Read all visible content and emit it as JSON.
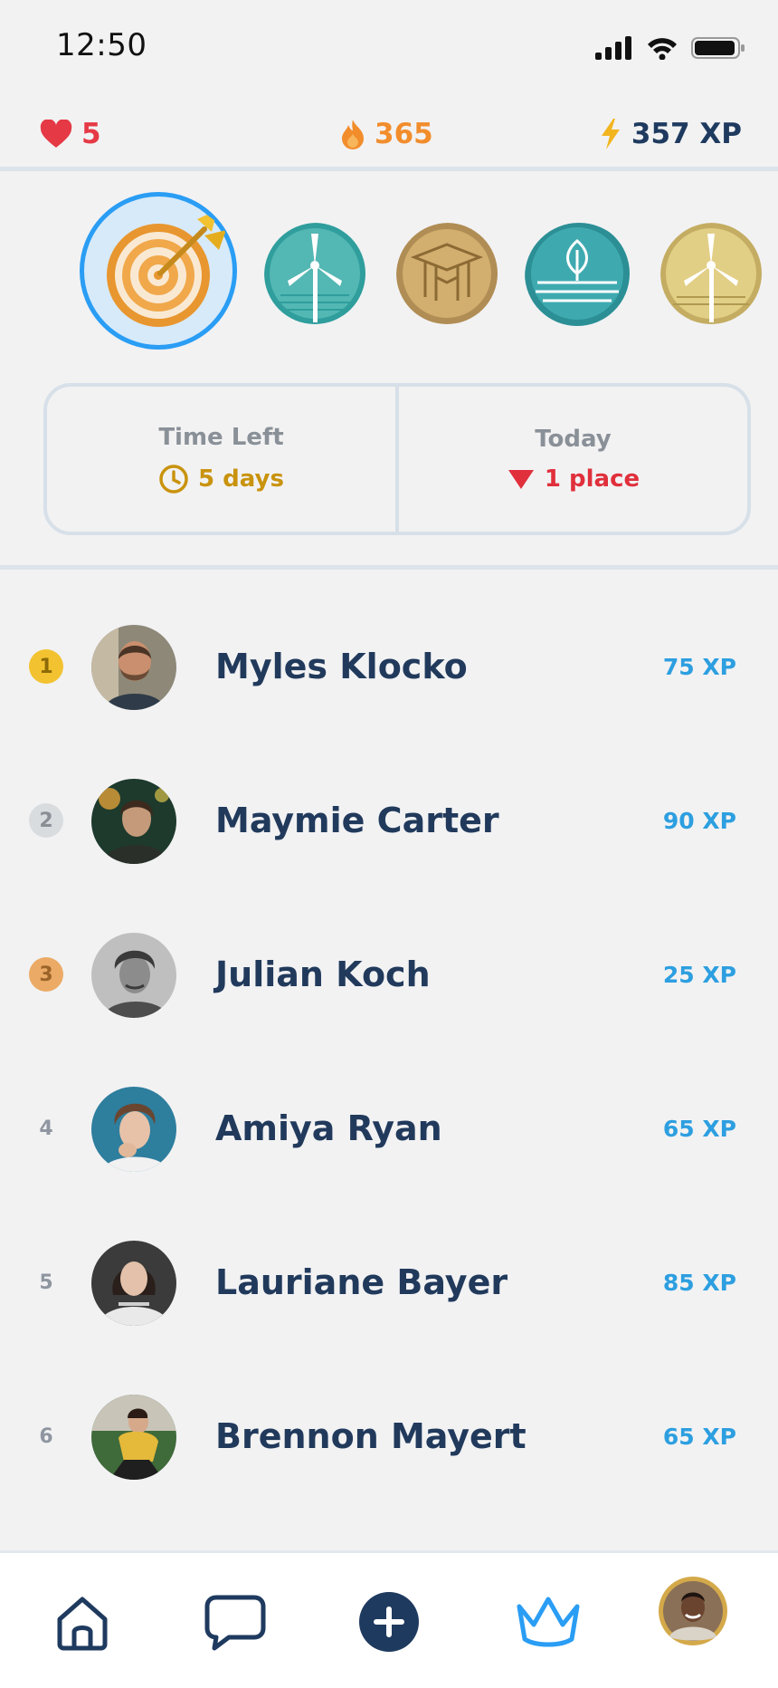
{
  "status": {
    "time": "12:50"
  },
  "stats": {
    "hearts": "5",
    "streak": "365",
    "xp": "357 XP"
  },
  "badges": [
    {
      "name": "target-badge",
      "selected": true
    },
    {
      "name": "wind-turbine-badge-teal"
    },
    {
      "name": "graduation-badge-gold"
    },
    {
      "name": "leaf-water-badge-teal"
    },
    {
      "name": "wind-turbine-badge-gold"
    }
  ],
  "info": {
    "time_left_label": "Time Left",
    "time_left_value": "5 days",
    "today_label": "Today",
    "today_value": "1 place"
  },
  "leaderboard": [
    {
      "rank": "1",
      "name": "Myles Klocko",
      "points": "75 XP"
    },
    {
      "rank": "2",
      "name": "Maymie Carter",
      "points": "90 XP"
    },
    {
      "rank": "3",
      "name": "Julian Koch",
      "points": "25 XP"
    },
    {
      "rank": "4",
      "name": "Amiya Ryan",
      "points": "65 XP"
    },
    {
      "rank": "5",
      "name": "Lauriane Bayer",
      "points": "85 XP"
    },
    {
      "rank": "6",
      "name": "Brennon Mayert",
      "points": "65 XP"
    }
  ],
  "colors": {
    "accent": "#2a9df4",
    "navy": "#1f3a5f",
    "heart": "#e53945",
    "streak": "#f28d2c",
    "gold": "#c9930e"
  },
  "tabs": [
    {
      "icon": "home-icon"
    },
    {
      "icon": "chat-icon"
    },
    {
      "icon": "add-icon"
    },
    {
      "icon": "crown-icon",
      "active": true
    },
    {
      "icon": "profile-avatar"
    }
  ]
}
